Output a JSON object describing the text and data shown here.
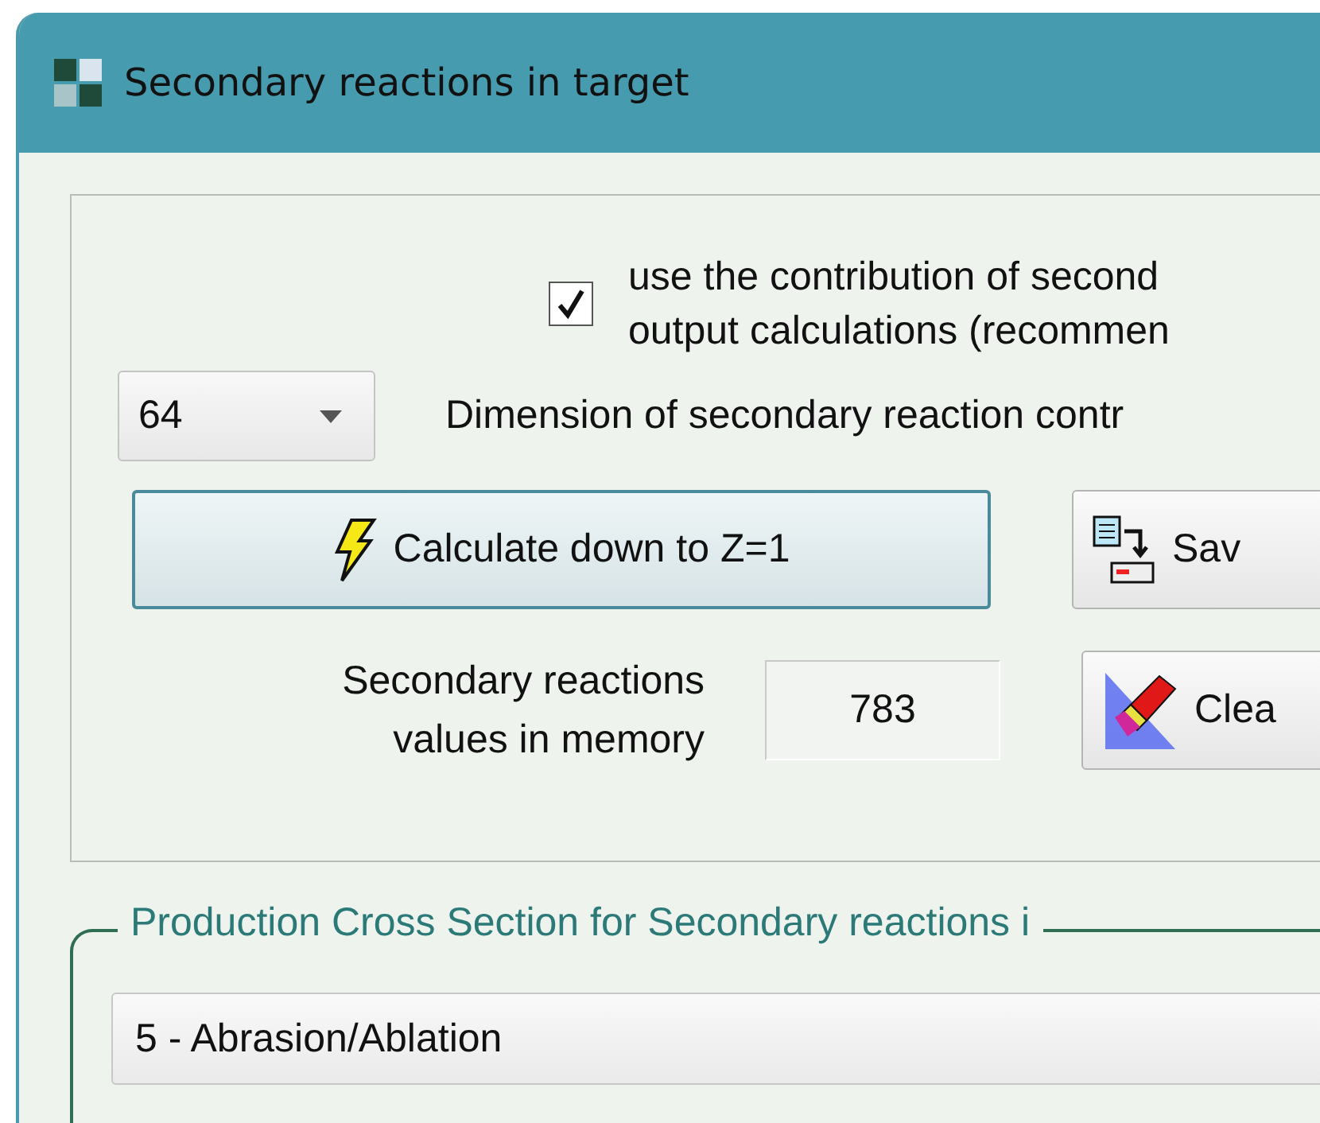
{
  "window": {
    "title": "Secondary reactions in target"
  },
  "use_contribution": {
    "checked": true,
    "label": "use the contribution of second\noutput calculations (recommen"
  },
  "dimension": {
    "value": "64",
    "label": "Dimension of secondary reaction contr"
  },
  "buttons": [
    {
      "kind": "calculate",
      "label": "Calculate down to Z=1"
    },
    {
      "kind": "save",
      "label": "Sav"
    },
    {
      "kind": "clear",
      "label": "Clea"
    }
  ],
  "memory": {
    "label": "Secondary reactions\nvalues in memory",
    "value": "783"
  },
  "cross_section": {
    "legend": "Production Cross Section for Secondary reactions i",
    "value": "5 - Abrasion/Ablation"
  }
}
